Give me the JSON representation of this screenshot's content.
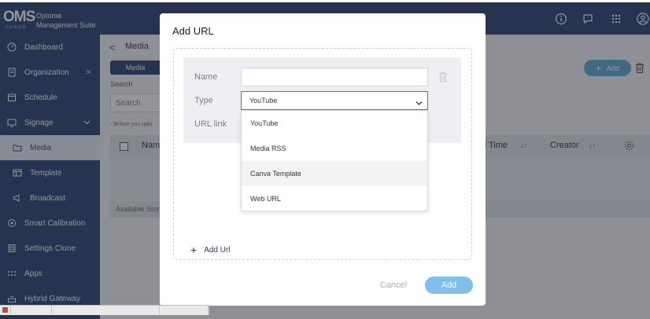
{
  "header": {
    "logo_text": "OMS",
    "logo_sub": "CLOUD",
    "brand_line1": "Optoma",
    "brand_line2": "Management Suite",
    "icons": [
      "info-icon",
      "chat-icon",
      "apps-grid-icon",
      "user-icon"
    ]
  },
  "sidebar": {
    "items": [
      {
        "label": "Dashboard",
        "icon": "dashboard-icon"
      },
      {
        "label": "Organization",
        "icon": "organization-icon",
        "chevron": ">"
      },
      {
        "label": "Schedule",
        "icon": "calendar-icon"
      },
      {
        "label": "Signage",
        "icon": "monitor-icon",
        "chevron": "v"
      },
      {
        "label": "Media",
        "icon": "folder-icon",
        "active": true
      },
      {
        "label": "Template",
        "icon": "template-icon"
      },
      {
        "label": "Broadcast",
        "icon": "megaphone-icon"
      },
      {
        "label": "Smart Calibration",
        "icon": "target-icon"
      },
      {
        "label": "Settings Clone",
        "icon": "clone-icon"
      },
      {
        "label": "Apps",
        "icon": "apps-icon"
      },
      {
        "label": "Hybrid Gateway",
        "icon": "gateway-icon"
      }
    ]
  },
  "page": {
    "back": "<",
    "title": "Media",
    "tab_media": "Media",
    "search_label": "Search",
    "search_placeholder": "Search",
    "upload_note": "- Before you uplo",
    "table": {
      "col_name": "Nam",
      "col_time": "d Time",
      "col_creator": "Creator",
      "sort_glyph": "↓↑"
    },
    "storage_label": "Available Stor",
    "add_button": "Add",
    "add_plus": "+"
  },
  "modal": {
    "title": "Add URL",
    "name_label": "Name",
    "name_value": "",
    "type_label": "Type",
    "type_value": "YouTube",
    "url_label": "URL link",
    "options": [
      "YouTube",
      "Media RSS",
      "Canva Template",
      "Web URL"
    ],
    "hovered_option": "Canva Template",
    "add_url": "Add Url",
    "add_url_plus": "+",
    "cancel": "Cancel",
    "confirm": "Add"
  },
  "colors": {
    "navy": "#253a6e",
    "accent_blue": "#5aa6d8",
    "confirm_blue": "#7ec0ea"
  }
}
